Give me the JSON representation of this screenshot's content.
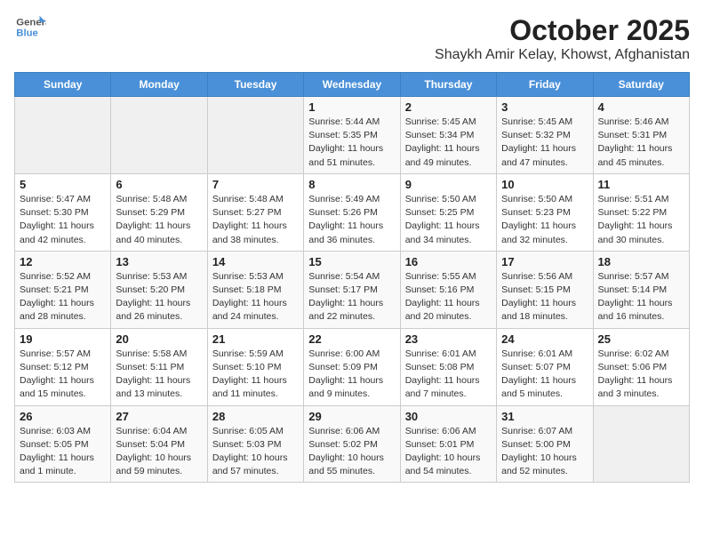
{
  "logo": {
    "line1": "General",
    "line2": "Blue"
  },
  "title": "October 2025",
  "subtitle": "Shaykh Amir Kelay, Khowst, Afghanistan",
  "weekdays": [
    "Sunday",
    "Monday",
    "Tuesday",
    "Wednesday",
    "Thursday",
    "Friday",
    "Saturday"
  ],
  "weeks": [
    [
      {
        "day": "",
        "info": ""
      },
      {
        "day": "",
        "info": ""
      },
      {
        "day": "",
        "info": ""
      },
      {
        "day": "1",
        "info": "Sunrise: 5:44 AM\nSunset: 5:35 PM\nDaylight: 11 hours\nand 51 minutes."
      },
      {
        "day": "2",
        "info": "Sunrise: 5:45 AM\nSunset: 5:34 PM\nDaylight: 11 hours\nand 49 minutes."
      },
      {
        "day": "3",
        "info": "Sunrise: 5:45 AM\nSunset: 5:32 PM\nDaylight: 11 hours\nand 47 minutes."
      },
      {
        "day": "4",
        "info": "Sunrise: 5:46 AM\nSunset: 5:31 PM\nDaylight: 11 hours\nand 45 minutes."
      }
    ],
    [
      {
        "day": "5",
        "info": "Sunrise: 5:47 AM\nSunset: 5:30 PM\nDaylight: 11 hours\nand 42 minutes."
      },
      {
        "day": "6",
        "info": "Sunrise: 5:48 AM\nSunset: 5:29 PM\nDaylight: 11 hours\nand 40 minutes."
      },
      {
        "day": "7",
        "info": "Sunrise: 5:48 AM\nSunset: 5:27 PM\nDaylight: 11 hours\nand 38 minutes."
      },
      {
        "day": "8",
        "info": "Sunrise: 5:49 AM\nSunset: 5:26 PM\nDaylight: 11 hours\nand 36 minutes."
      },
      {
        "day": "9",
        "info": "Sunrise: 5:50 AM\nSunset: 5:25 PM\nDaylight: 11 hours\nand 34 minutes."
      },
      {
        "day": "10",
        "info": "Sunrise: 5:50 AM\nSunset: 5:23 PM\nDaylight: 11 hours\nand 32 minutes."
      },
      {
        "day": "11",
        "info": "Sunrise: 5:51 AM\nSunset: 5:22 PM\nDaylight: 11 hours\nand 30 minutes."
      }
    ],
    [
      {
        "day": "12",
        "info": "Sunrise: 5:52 AM\nSunset: 5:21 PM\nDaylight: 11 hours\nand 28 minutes."
      },
      {
        "day": "13",
        "info": "Sunrise: 5:53 AM\nSunset: 5:20 PM\nDaylight: 11 hours\nand 26 minutes."
      },
      {
        "day": "14",
        "info": "Sunrise: 5:53 AM\nSunset: 5:18 PM\nDaylight: 11 hours\nand 24 minutes."
      },
      {
        "day": "15",
        "info": "Sunrise: 5:54 AM\nSunset: 5:17 PM\nDaylight: 11 hours\nand 22 minutes."
      },
      {
        "day": "16",
        "info": "Sunrise: 5:55 AM\nSunset: 5:16 PM\nDaylight: 11 hours\nand 20 minutes."
      },
      {
        "day": "17",
        "info": "Sunrise: 5:56 AM\nSunset: 5:15 PM\nDaylight: 11 hours\nand 18 minutes."
      },
      {
        "day": "18",
        "info": "Sunrise: 5:57 AM\nSunset: 5:14 PM\nDaylight: 11 hours\nand 16 minutes."
      }
    ],
    [
      {
        "day": "19",
        "info": "Sunrise: 5:57 AM\nSunset: 5:12 PM\nDaylight: 11 hours\nand 15 minutes."
      },
      {
        "day": "20",
        "info": "Sunrise: 5:58 AM\nSunset: 5:11 PM\nDaylight: 11 hours\nand 13 minutes."
      },
      {
        "day": "21",
        "info": "Sunrise: 5:59 AM\nSunset: 5:10 PM\nDaylight: 11 hours\nand 11 minutes."
      },
      {
        "day": "22",
        "info": "Sunrise: 6:00 AM\nSunset: 5:09 PM\nDaylight: 11 hours\nand 9 minutes."
      },
      {
        "day": "23",
        "info": "Sunrise: 6:01 AM\nSunset: 5:08 PM\nDaylight: 11 hours\nand 7 minutes."
      },
      {
        "day": "24",
        "info": "Sunrise: 6:01 AM\nSunset: 5:07 PM\nDaylight: 11 hours\nand 5 minutes."
      },
      {
        "day": "25",
        "info": "Sunrise: 6:02 AM\nSunset: 5:06 PM\nDaylight: 11 hours\nand 3 minutes."
      }
    ],
    [
      {
        "day": "26",
        "info": "Sunrise: 6:03 AM\nSunset: 5:05 PM\nDaylight: 11 hours\nand 1 minute."
      },
      {
        "day": "27",
        "info": "Sunrise: 6:04 AM\nSunset: 5:04 PM\nDaylight: 10 hours\nand 59 minutes."
      },
      {
        "day": "28",
        "info": "Sunrise: 6:05 AM\nSunset: 5:03 PM\nDaylight: 10 hours\nand 57 minutes."
      },
      {
        "day": "29",
        "info": "Sunrise: 6:06 AM\nSunset: 5:02 PM\nDaylight: 10 hours\nand 55 minutes."
      },
      {
        "day": "30",
        "info": "Sunrise: 6:06 AM\nSunset: 5:01 PM\nDaylight: 10 hours\nand 54 minutes."
      },
      {
        "day": "31",
        "info": "Sunrise: 6:07 AM\nSunset: 5:00 PM\nDaylight: 10 hours\nand 52 minutes."
      },
      {
        "day": "",
        "info": ""
      }
    ]
  ]
}
